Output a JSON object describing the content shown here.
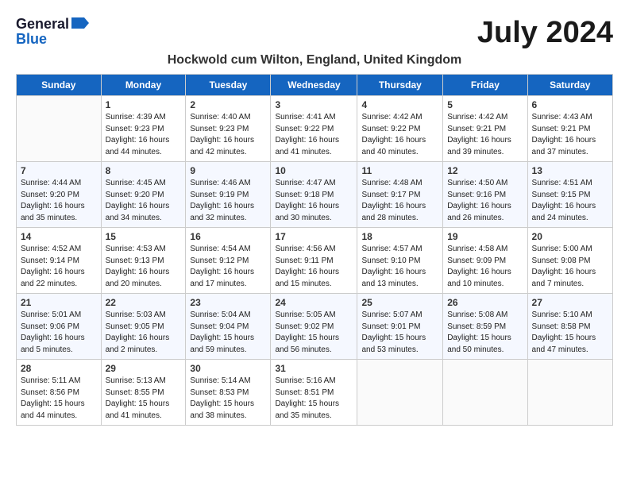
{
  "logo": {
    "general": "General",
    "blue": "Blue"
  },
  "title": "July 2024",
  "location": "Hockwold cum Wilton, England, United Kingdom",
  "days_of_week": [
    "Sunday",
    "Monday",
    "Tuesday",
    "Wednesday",
    "Thursday",
    "Friday",
    "Saturday"
  ],
  "weeks": [
    [
      {
        "day": "",
        "sunrise": "",
        "sunset": "",
        "daylight": ""
      },
      {
        "day": "1",
        "sunrise": "Sunrise: 4:39 AM",
        "sunset": "Sunset: 9:23 PM",
        "daylight": "Daylight: 16 hours and 44 minutes."
      },
      {
        "day": "2",
        "sunrise": "Sunrise: 4:40 AM",
        "sunset": "Sunset: 9:23 PM",
        "daylight": "Daylight: 16 hours and 42 minutes."
      },
      {
        "day": "3",
        "sunrise": "Sunrise: 4:41 AM",
        "sunset": "Sunset: 9:22 PM",
        "daylight": "Daylight: 16 hours and 41 minutes."
      },
      {
        "day": "4",
        "sunrise": "Sunrise: 4:42 AM",
        "sunset": "Sunset: 9:22 PM",
        "daylight": "Daylight: 16 hours and 40 minutes."
      },
      {
        "day": "5",
        "sunrise": "Sunrise: 4:42 AM",
        "sunset": "Sunset: 9:21 PM",
        "daylight": "Daylight: 16 hours and 39 minutes."
      },
      {
        "day": "6",
        "sunrise": "Sunrise: 4:43 AM",
        "sunset": "Sunset: 9:21 PM",
        "daylight": "Daylight: 16 hours and 37 minutes."
      }
    ],
    [
      {
        "day": "7",
        "sunrise": "Sunrise: 4:44 AM",
        "sunset": "Sunset: 9:20 PM",
        "daylight": "Daylight: 16 hours and 35 minutes."
      },
      {
        "day": "8",
        "sunrise": "Sunrise: 4:45 AM",
        "sunset": "Sunset: 9:20 PM",
        "daylight": "Daylight: 16 hours and 34 minutes."
      },
      {
        "day": "9",
        "sunrise": "Sunrise: 4:46 AM",
        "sunset": "Sunset: 9:19 PM",
        "daylight": "Daylight: 16 hours and 32 minutes."
      },
      {
        "day": "10",
        "sunrise": "Sunrise: 4:47 AM",
        "sunset": "Sunset: 9:18 PM",
        "daylight": "Daylight: 16 hours and 30 minutes."
      },
      {
        "day": "11",
        "sunrise": "Sunrise: 4:48 AM",
        "sunset": "Sunset: 9:17 PM",
        "daylight": "Daylight: 16 hours and 28 minutes."
      },
      {
        "day": "12",
        "sunrise": "Sunrise: 4:50 AM",
        "sunset": "Sunset: 9:16 PM",
        "daylight": "Daylight: 16 hours and 26 minutes."
      },
      {
        "day": "13",
        "sunrise": "Sunrise: 4:51 AM",
        "sunset": "Sunset: 9:15 PM",
        "daylight": "Daylight: 16 hours and 24 minutes."
      }
    ],
    [
      {
        "day": "14",
        "sunrise": "Sunrise: 4:52 AM",
        "sunset": "Sunset: 9:14 PM",
        "daylight": "Daylight: 16 hours and 22 minutes."
      },
      {
        "day": "15",
        "sunrise": "Sunrise: 4:53 AM",
        "sunset": "Sunset: 9:13 PM",
        "daylight": "Daylight: 16 hours and 20 minutes."
      },
      {
        "day": "16",
        "sunrise": "Sunrise: 4:54 AM",
        "sunset": "Sunset: 9:12 PM",
        "daylight": "Daylight: 16 hours and 17 minutes."
      },
      {
        "day": "17",
        "sunrise": "Sunrise: 4:56 AM",
        "sunset": "Sunset: 9:11 PM",
        "daylight": "Daylight: 16 hours and 15 minutes."
      },
      {
        "day": "18",
        "sunrise": "Sunrise: 4:57 AM",
        "sunset": "Sunset: 9:10 PM",
        "daylight": "Daylight: 16 hours and 13 minutes."
      },
      {
        "day": "19",
        "sunrise": "Sunrise: 4:58 AM",
        "sunset": "Sunset: 9:09 PM",
        "daylight": "Daylight: 16 hours and 10 minutes."
      },
      {
        "day": "20",
        "sunrise": "Sunrise: 5:00 AM",
        "sunset": "Sunset: 9:08 PM",
        "daylight": "Daylight: 16 hours and 7 minutes."
      }
    ],
    [
      {
        "day": "21",
        "sunrise": "Sunrise: 5:01 AM",
        "sunset": "Sunset: 9:06 PM",
        "daylight": "Daylight: 16 hours and 5 minutes."
      },
      {
        "day": "22",
        "sunrise": "Sunrise: 5:03 AM",
        "sunset": "Sunset: 9:05 PM",
        "daylight": "Daylight: 16 hours and 2 minutes."
      },
      {
        "day": "23",
        "sunrise": "Sunrise: 5:04 AM",
        "sunset": "Sunset: 9:04 PM",
        "daylight": "Daylight: 15 hours and 59 minutes."
      },
      {
        "day": "24",
        "sunrise": "Sunrise: 5:05 AM",
        "sunset": "Sunset: 9:02 PM",
        "daylight": "Daylight: 15 hours and 56 minutes."
      },
      {
        "day": "25",
        "sunrise": "Sunrise: 5:07 AM",
        "sunset": "Sunset: 9:01 PM",
        "daylight": "Daylight: 15 hours and 53 minutes."
      },
      {
        "day": "26",
        "sunrise": "Sunrise: 5:08 AM",
        "sunset": "Sunset: 8:59 PM",
        "daylight": "Daylight: 15 hours and 50 minutes."
      },
      {
        "day": "27",
        "sunrise": "Sunrise: 5:10 AM",
        "sunset": "Sunset: 8:58 PM",
        "daylight": "Daylight: 15 hours and 47 minutes."
      }
    ],
    [
      {
        "day": "28",
        "sunrise": "Sunrise: 5:11 AM",
        "sunset": "Sunset: 8:56 PM",
        "daylight": "Daylight: 15 hours and 44 minutes."
      },
      {
        "day": "29",
        "sunrise": "Sunrise: 5:13 AM",
        "sunset": "Sunset: 8:55 PM",
        "daylight": "Daylight: 15 hours and 41 minutes."
      },
      {
        "day": "30",
        "sunrise": "Sunrise: 5:14 AM",
        "sunset": "Sunset: 8:53 PM",
        "daylight": "Daylight: 15 hours and 38 minutes."
      },
      {
        "day": "31",
        "sunrise": "Sunrise: 5:16 AM",
        "sunset": "Sunset: 8:51 PM",
        "daylight": "Daylight: 15 hours and 35 minutes."
      },
      {
        "day": "",
        "sunrise": "",
        "sunset": "",
        "daylight": ""
      },
      {
        "day": "",
        "sunrise": "",
        "sunset": "",
        "daylight": ""
      },
      {
        "day": "",
        "sunrise": "",
        "sunset": "",
        "daylight": ""
      }
    ]
  ]
}
